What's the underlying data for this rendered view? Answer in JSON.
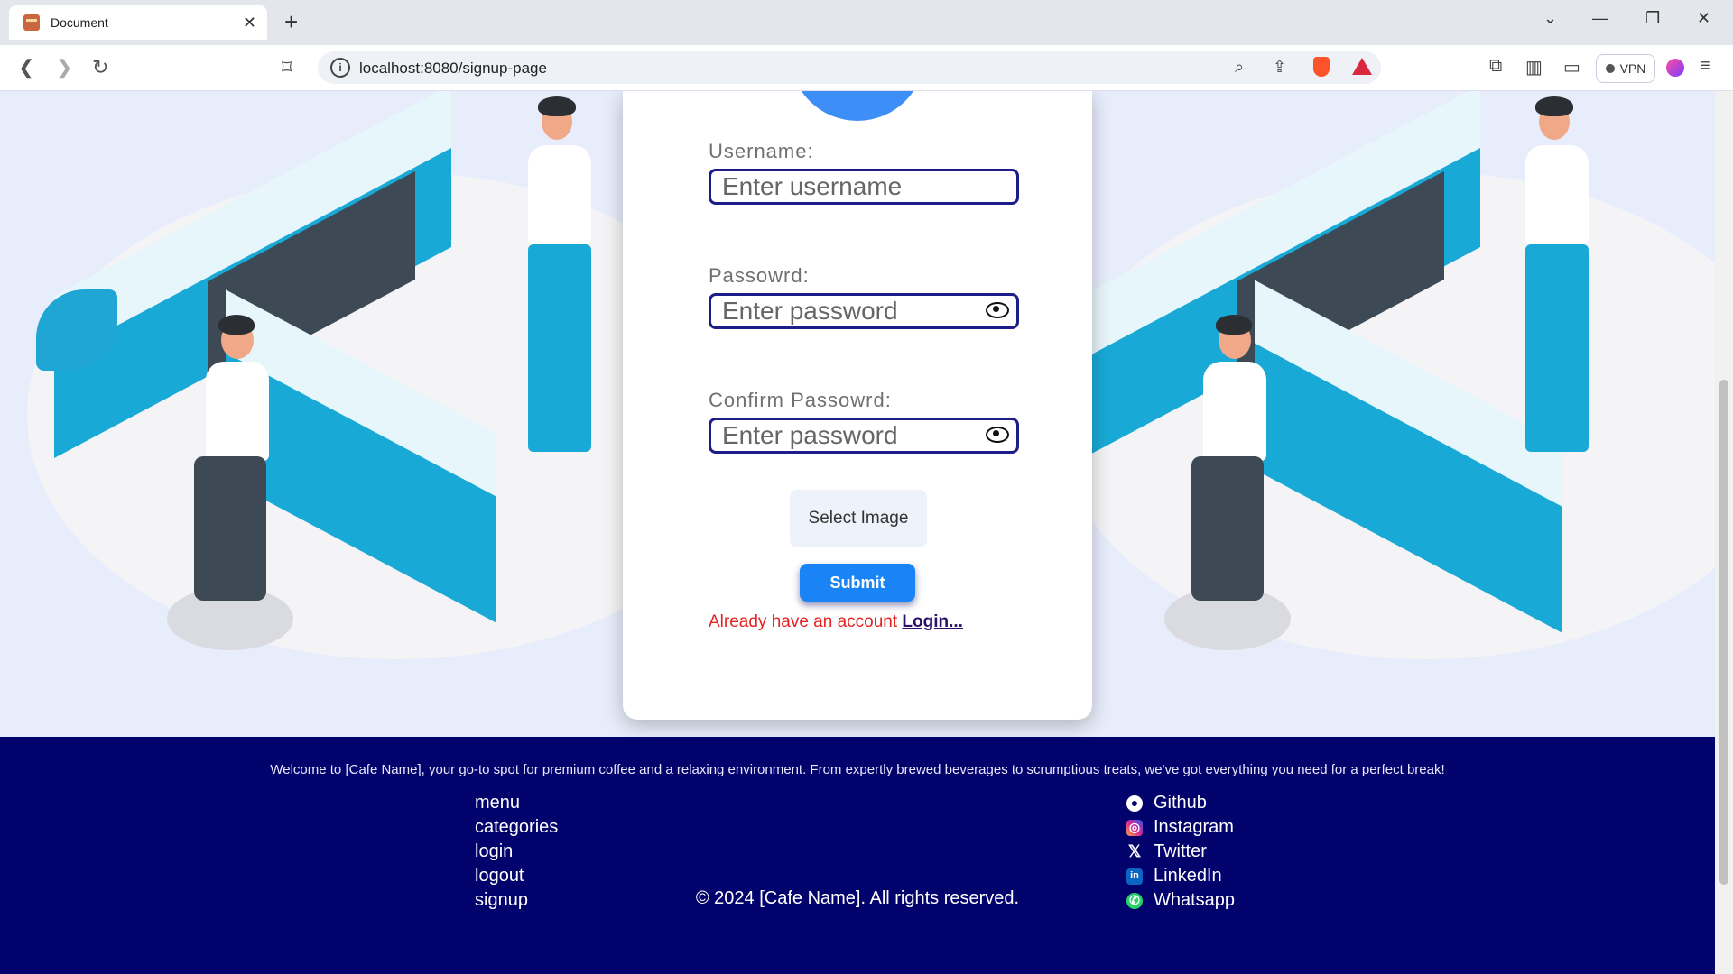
{
  "browser": {
    "tab_title": "Document",
    "tab_close": "✕",
    "new_tab": "+",
    "url": "localhost:8080/signup-page",
    "vpn_label": "VPN",
    "window_controls": [
      "⌄",
      "—",
      "❐",
      "✕"
    ]
  },
  "form": {
    "username_label": "Username:",
    "username_placeholder": "Enter username",
    "password_label": "Passowrd:",
    "password_placeholder": "Enter password",
    "confirm_label": "Confirm Passowrd:",
    "confirm_placeholder": "Enter password",
    "select_image": "Select Image",
    "submit": "Submit",
    "login_prompt": "Already have an account",
    "login_link": "Login..."
  },
  "footer": {
    "welcome": "Welcome to [Cafe Name], your go-to spot for premium coffee and a relaxing environment. From expertly brewed beverages to scrumptious treats, we've got everything you need for a perfect break!",
    "links": [
      "menu",
      "categories",
      "login",
      "logout",
      "signup"
    ],
    "social": [
      {
        "label": "Github",
        "icon": "github-icon"
      },
      {
        "label": "Instagram",
        "icon": "instagram-icon"
      },
      {
        "label": "Twitter",
        "icon": "x-icon"
      },
      {
        "label": "LinkedIn",
        "icon": "linkedin-icon"
      },
      {
        "label": "Whatsapp",
        "icon": "whatsapp-icon"
      }
    ],
    "copyright": "© 2024 [Cafe Name]. All rights reserved."
  },
  "colors": {
    "footer_bg": "#01026b",
    "submit_bg": "#1a84f7",
    "input_border": "#1c1c8a",
    "login_prompt": "#e52222"
  }
}
